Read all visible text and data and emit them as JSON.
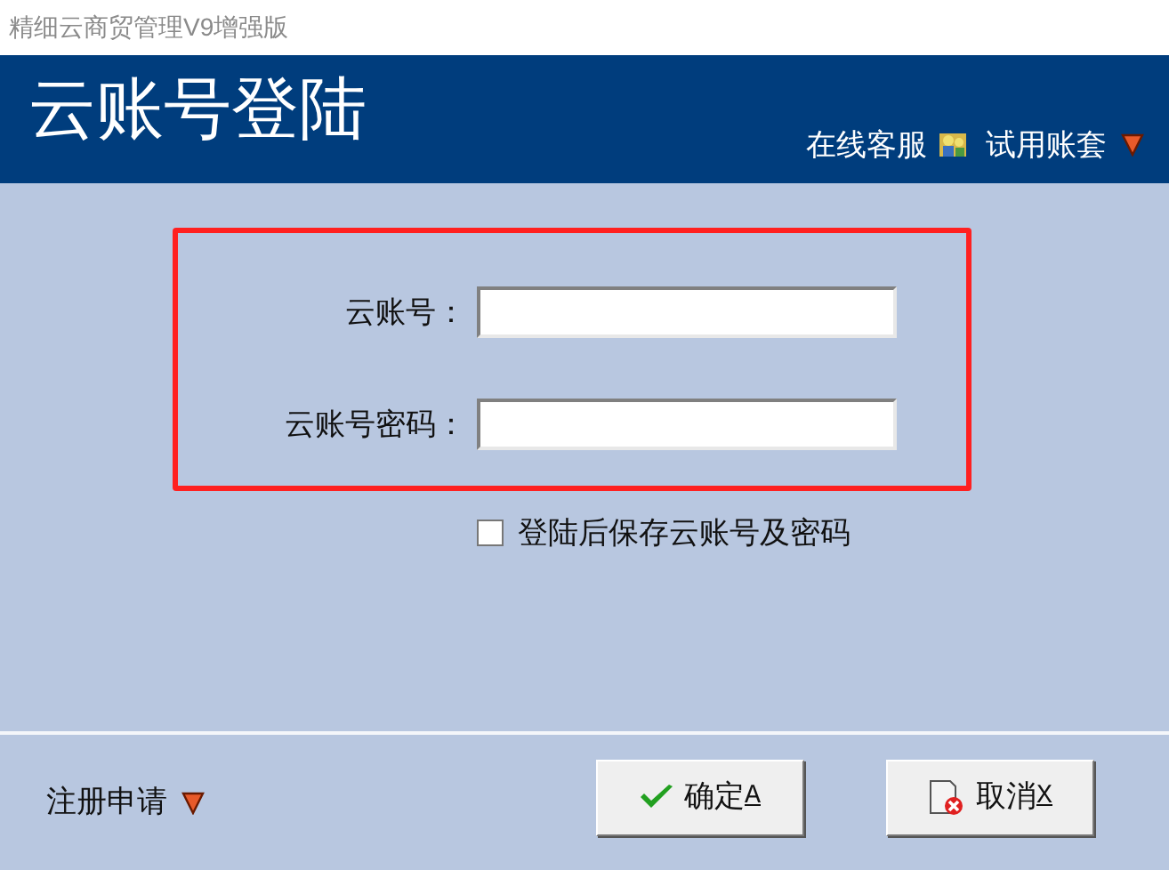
{
  "window": {
    "title": "精细云商贸管理V9增强版"
  },
  "header": {
    "title": "云账号登陆",
    "links": [
      {
        "label": "在线客服",
        "kind": "service"
      },
      {
        "label": "试用账套",
        "kind": "dropdown"
      }
    ]
  },
  "form": {
    "fields": [
      {
        "label": "云账号："
      },
      {
        "label": "云账号密码："
      }
    ],
    "remember": {
      "label": "登陆后保存云账号及密码",
      "checked": false
    }
  },
  "footer": {
    "register": {
      "label": "注册申请"
    },
    "buttons": [
      {
        "label": "确定",
        "accelerator": "A",
        "kind": "ok"
      },
      {
        "label": "取消",
        "accelerator": "X",
        "kind": "cancel"
      }
    ]
  }
}
